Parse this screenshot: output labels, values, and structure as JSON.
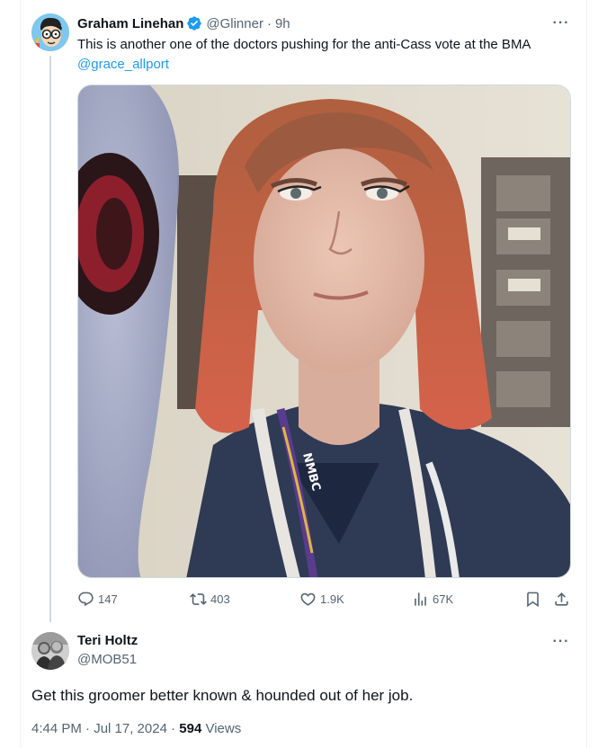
{
  "tweet": {
    "author": {
      "display_name": "Graham Linehan",
      "handle": "@Glinner",
      "verified": true,
      "avatar_icon": "cartoon-avatar-icon"
    },
    "separator": "·",
    "time": "9h",
    "text_main": "This is another one of the doctors pushing for the anti-Cass vote at the BMA ",
    "mention": "@grace_allport",
    "more_label": "···",
    "media": {
      "lanyard_text": "NMBC"
    },
    "actions": {
      "replies": "147",
      "retweets": "403",
      "likes": "1.9K",
      "views": "67K"
    }
  },
  "reply": {
    "author": {
      "display_name": "Teri Holtz",
      "handle": "@MOB51"
    },
    "more_label": "···",
    "text": "Get this groomer better known & hounded out of her job.",
    "time": "4:44 PM · Jul 17, 2024 · ",
    "view_count": "594",
    "views_label": " Views"
  },
  "colors": {
    "accent": "#1d9bf0",
    "secondary_text": "#536471",
    "primary_text": "#0f1419",
    "border": "#eff3f4"
  }
}
